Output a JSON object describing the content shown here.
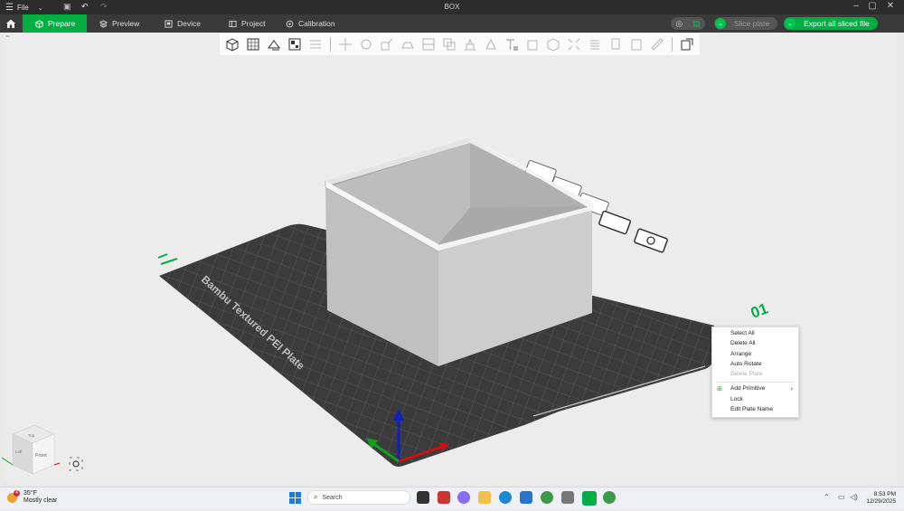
{
  "window": {
    "title": "BOX",
    "file_menu": "File"
  },
  "tabs": [
    {
      "label": "Prepare",
      "icon": "cube-icon",
      "active": true
    },
    {
      "label": "Preview",
      "icon": "layers-icon",
      "active": false
    },
    {
      "label": "Device",
      "icon": "device-icon",
      "active": false
    },
    {
      "label": "Project",
      "icon": "project-icon",
      "active": false
    },
    {
      "label": "Calibration",
      "icon": "calibration-icon",
      "active": false
    }
  ],
  "actions": {
    "slice_label": "Slice plate",
    "export_label": "Export all sliced file"
  },
  "plate": {
    "name": "Bambu Textured PEI Plate",
    "number": "01"
  },
  "context_menu": {
    "items": [
      {
        "label": "Select All",
        "enabled": true
      },
      {
        "label": "Delete All",
        "enabled": true
      },
      {
        "label": "Arrange",
        "enabled": true
      },
      {
        "label": "Auto Rotate",
        "enabled": true
      },
      {
        "label": "Delete Plate",
        "enabled": false
      },
      {
        "label": "Add Primitive",
        "enabled": true,
        "submenu": true
      },
      {
        "label": "Lock",
        "enabled": true
      },
      {
        "label": "Edit Plate Name",
        "enabled": true
      }
    ]
  },
  "view_cube": {
    "front": "Front",
    "top": "Top",
    "left": "Left"
  },
  "taskbar": {
    "weather_temp": "35°F",
    "weather_desc": "Mostly clear",
    "weather_badge": "4",
    "search_placeholder": "Search",
    "time": "8:53 PM",
    "date": "12/29/2025"
  },
  "colors": {
    "accent": "#00ae42",
    "toolbar_bg": "#3a3a3a",
    "titlebar_bg": "#2c2c2c",
    "plate": "#3b3b3b",
    "model": "#c4c4c4"
  }
}
